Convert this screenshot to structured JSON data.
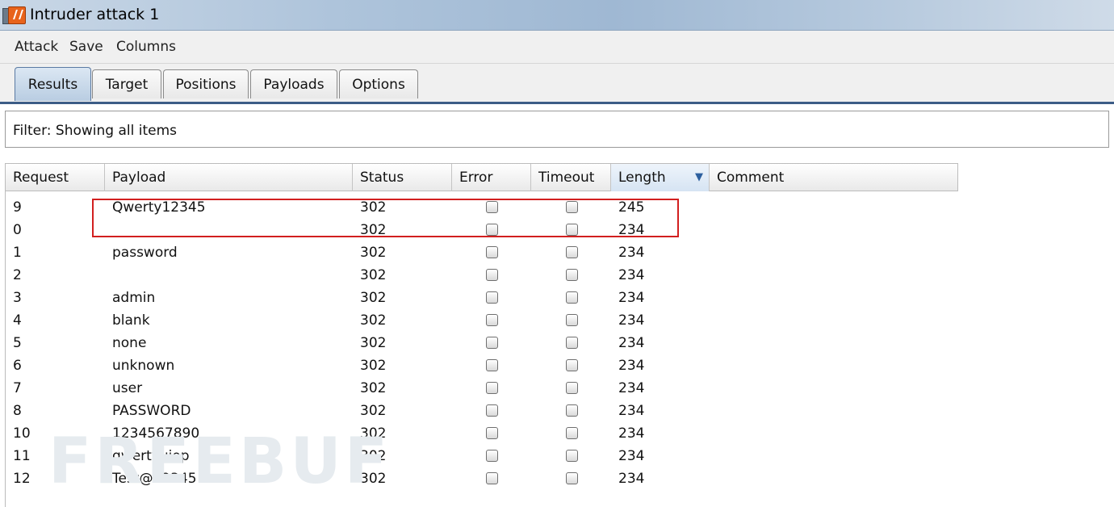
{
  "window": {
    "title": "Intruder attack 1"
  },
  "menu": [
    "Attack",
    "Save",
    "Columns"
  ],
  "tabs": [
    {
      "label": "Results",
      "active": true
    },
    {
      "label": "Target",
      "active": false
    },
    {
      "label": "Positions",
      "active": false
    },
    {
      "label": "Payloads",
      "active": false
    },
    {
      "label": "Options",
      "active": false
    }
  ],
  "filter": {
    "text": "Filter: Showing all items"
  },
  "table": {
    "columns": [
      "Request",
      "Payload",
      "Status",
      "Error",
      "Timeout",
      "Length",
      "Comment"
    ],
    "sorted_column": "Length",
    "rows": [
      {
        "request": "9",
        "payload": "Qwerty12345",
        "status": "302",
        "error": false,
        "timeout": false,
        "length": "245",
        "comment": ""
      },
      {
        "request": "0",
        "payload": "",
        "status": "302",
        "error": false,
        "timeout": false,
        "length": "234",
        "comment": ""
      },
      {
        "request": "1",
        "payload": "password",
        "status": "302",
        "error": false,
        "timeout": false,
        "length": "234",
        "comment": ""
      },
      {
        "request": "2",
        "payload": "",
        "status": "302",
        "error": false,
        "timeout": false,
        "length": "234",
        "comment": ""
      },
      {
        "request": "3",
        "payload": "admin",
        "status": "302",
        "error": false,
        "timeout": false,
        "length": "234",
        "comment": ""
      },
      {
        "request": "4",
        "payload": "blank",
        "status": "302",
        "error": false,
        "timeout": false,
        "length": "234",
        "comment": ""
      },
      {
        "request": "5",
        "payload": "none",
        "status": "302",
        "error": false,
        "timeout": false,
        "length": "234",
        "comment": ""
      },
      {
        "request": "6",
        "payload": "unknown",
        "status": "302",
        "error": false,
        "timeout": false,
        "length": "234",
        "comment": ""
      },
      {
        "request": "7",
        "payload": "user",
        "status": "302",
        "error": false,
        "timeout": false,
        "length": "234",
        "comment": ""
      },
      {
        "request": "8",
        "payload": "PASSWORD",
        "status": "302",
        "error": false,
        "timeout": false,
        "length": "234",
        "comment": ""
      },
      {
        "request": "10",
        "payload": "1234567890",
        "status": "302",
        "error": false,
        "timeout": false,
        "length": "234",
        "comment": ""
      },
      {
        "request": "11",
        "payload": "qwertyuiop",
        "status": "302",
        "error": false,
        "timeout": false,
        "length": "234",
        "comment": ""
      },
      {
        "request": "12",
        "payload": "Test@12345",
        "status": "302",
        "error": false,
        "timeout": false,
        "length": "234",
        "comment": ""
      }
    ]
  },
  "annotation": {
    "color": "#d21f1f"
  },
  "watermark": {
    "text": "FREEBUF"
  },
  "colors": {
    "tab_accent": "#3c5c86",
    "sort_arrow": "#2c5f9e",
    "app_icon": "#e8631b"
  },
  "icons": {
    "app": "burp-suite-icon",
    "sort": "sort-descending-icon",
    "checkbox": "checkbox-unchecked-icon"
  }
}
